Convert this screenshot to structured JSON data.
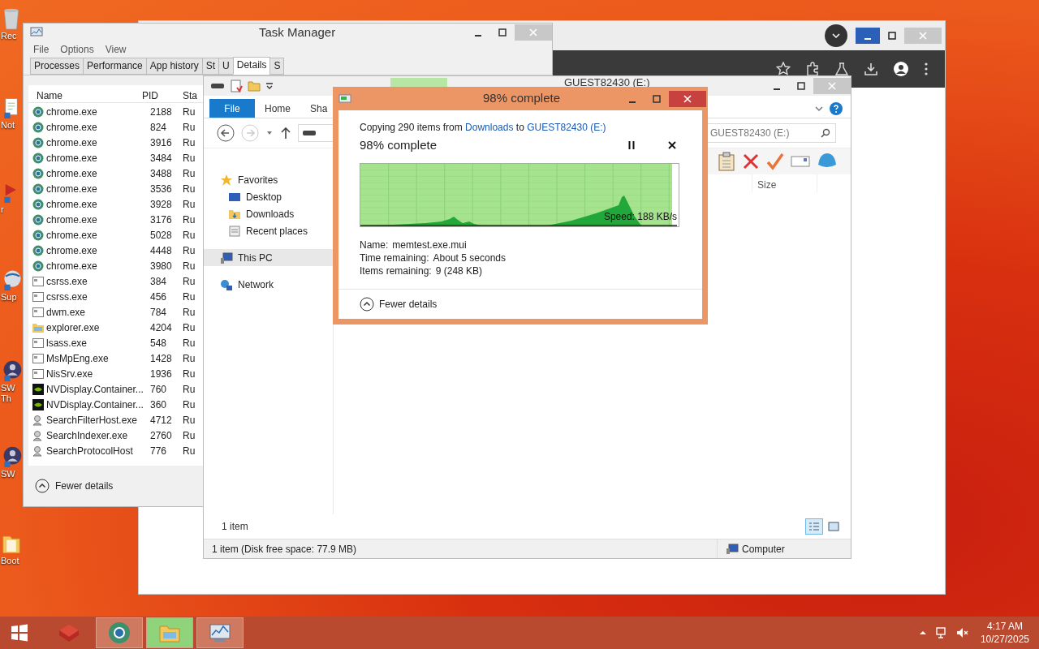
{
  "desktop_icons": [
    {
      "label": "Rec",
      "kind": "bin"
    },
    {
      "label": "Not",
      "kind": "notepad"
    },
    {
      "label": "r",
      "kind": "app"
    },
    {
      "label": "Sup",
      "kind": "globe"
    },
    {
      "label": "SW Th",
      "kind": "avatar"
    },
    {
      "label": "SW",
      "kind": "avatar"
    },
    {
      "label": "Boot",
      "kind": "folder"
    }
  ],
  "task_manager": {
    "title": "Task Manager",
    "menu": [
      "File",
      "Options",
      "View"
    ],
    "tabs": [
      {
        "label": "Processes",
        "selected": false
      },
      {
        "label": "Performance",
        "selected": false
      },
      {
        "label": "App history",
        "selected": false
      },
      {
        "label": "St",
        "selected": false
      },
      {
        "label": "U",
        "selected": false
      },
      {
        "label": "Details",
        "selected": true
      },
      {
        "label": "S",
        "selected": false
      }
    ],
    "columns": [
      "Name",
      "PID",
      "Sta"
    ],
    "rows": [
      {
        "name": "chrome.exe",
        "pid": "2188",
        "status": "Ru",
        "kind": "chrome"
      },
      {
        "name": "chrome.exe",
        "pid": "824",
        "status": "Ru",
        "kind": "chrome"
      },
      {
        "name": "chrome.exe",
        "pid": "3916",
        "status": "Ru",
        "kind": "chrome"
      },
      {
        "name": "chrome.exe",
        "pid": "3484",
        "status": "Ru",
        "kind": "chrome"
      },
      {
        "name": "chrome.exe",
        "pid": "3488",
        "status": "Ru",
        "kind": "chrome"
      },
      {
        "name": "chrome.exe",
        "pid": "3536",
        "status": "Ru",
        "kind": "chrome"
      },
      {
        "name": "chrome.exe",
        "pid": "3928",
        "status": "Ru",
        "kind": "chrome"
      },
      {
        "name": "chrome.exe",
        "pid": "3176",
        "status": "Ru",
        "kind": "chrome"
      },
      {
        "name": "chrome.exe",
        "pid": "5028",
        "status": "Ru",
        "kind": "chrome"
      },
      {
        "name": "chrome.exe",
        "pid": "4448",
        "status": "Ru",
        "kind": "chrome"
      },
      {
        "name": "chrome.exe",
        "pid": "3980",
        "status": "Ru",
        "kind": "chrome"
      },
      {
        "name": "csrss.exe",
        "pid": "384",
        "status": "Ru",
        "kind": "window"
      },
      {
        "name": "csrss.exe",
        "pid": "456",
        "status": "Ru",
        "kind": "window"
      },
      {
        "name": "dwm.exe",
        "pid": "784",
        "status": "Ru",
        "kind": "window"
      },
      {
        "name": "explorer.exe",
        "pid": "4204",
        "status": "Ru",
        "kind": "folder"
      },
      {
        "name": "lsass.exe",
        "pid": "548",
        "status": "Ru",
        "kind": "window"
      },
      {
        "name": "MsMpEng.exe",
        "pid": "1428",
        "status": "Ru",
        "kind": "window"
      },
      {
        "name": "NisSrv.exe",
        "pid": "1936",
        "status": "Ru",
        "kind": "window"
      },
      {
        "name": "NVDisplay.Container...",
        "pid": "760",
        "status": "Ru",
        "kind": "nvidia"
      },
      {
        "name": "NVDisplay.Container...",
        "pid": "360",
        "status": "Ru",
        "kind": "nvidia"
      },
      {
        "name": "SearchFilterHost.exe",
        "pid": "4712",
        "status": "Ru",
        "kind": "search"
      },
      {
        "name": "SearchIndexer.exe",
        "pid": "2760",
        "status": "Ru",
        "kind": "search"
      },
      {
        "name": "SearchProtocolHost",
        "pid": "776",
        "status": "Ru",
        "kind": "search"
      }
    ],
    "footer": "Fewer details"
  },
  "explorer": {
    "title": "GUEST82430 (E:)",
    "ribbon_tabs": [
      {
        "label": "File",
        "selected": true
      },
      {
        "label": "Home",
        "selected": false
      },
      {
        "label": "Sha",
        "selected": false
      }
    ],
    "search": {
      "placeholder": "GUEST82430 (E:)"
    },
    "columns": [
      "Size"
    ],
    "nav": [
      {
        "label": "Favorites",
        "kind": "star",
        "selected": false,
        "children": [
          {
            "label": "Desktop",
            "kind": "desktop",
            "selected": false
          },
          {
            "label": "Downloads",
            "kind": "downloads",
            "selected": false
          },
          {
            "label": "Recent places",
            "kind": "recent",
            "selected": false
          }
        ]
      },
      {
        "label": "This PC",
        "kind": "pc",
        "selected": true
      },
      {
        "label": "Network",
        "kind": "network",
        "selected": false
      }
    ],
    "item_count": "1 item",
    "status": "1 item (Disk free space: 77.9 MB)",
    "status_location": "Computer"
  },
  "copy_dialog": {
    "title": "98% complete",
    "summary": [
      "Copying 290 items from",
      "Downloads",
      "to",
      "GUEST82430 (E:)"
    ],
    "heading": "98% complete",
    "level": 0.98,
    "speed": "Speed: 188 KB/s",
    "details": [
      {
        "label": "Name:",
        "value": "memtest.exe.mui"
      },
      {
        "label": "Time remaining:",
        "value": "About 5 seconds"
      },
      {
        "label": "Items remaining:",
        "value": "9 (248 KB)"
      }
    ],
    "toggle": "Fewer details"
  },
  "taskbar": {
    "apps": [
      {
        "kind": "box",
        "running": false,
        "selected": false
      },
      {
        "kind": "chrome",
        "running": true,
        "selected": false
      },
      {
        "kind": "explorer",
        "running": true,
        "selected": true
      },
      {
        "kind": "taskmgr",
        "running": true,
        "selected": false
      }
    ],
    "time": "4:17 AM",
    "date": "10/27/2025"
  }
}
